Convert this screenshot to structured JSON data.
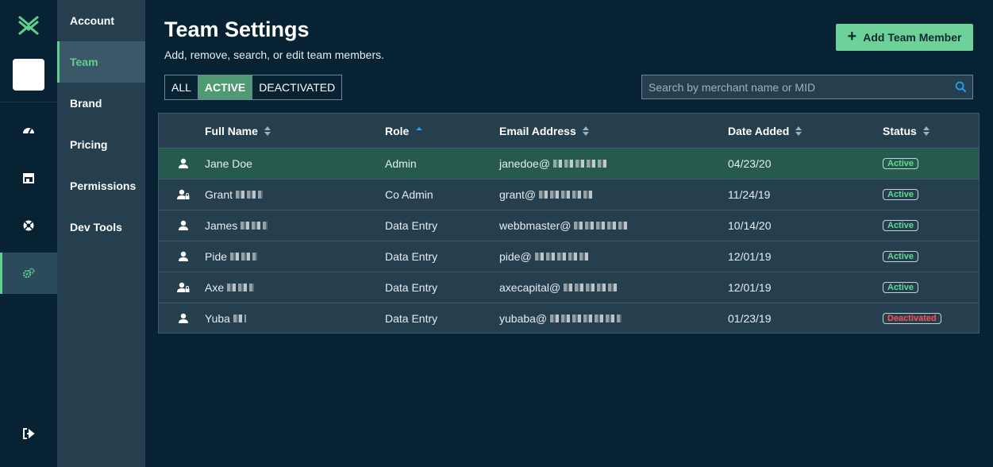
{
  "rail": {
    "icons": [
      "logo-icon",
      "dashboard-icon",
      "store-icon",
      "support-icon",
      "settings-icon",
      "logout-icon"
    ]
  },
  "subnav": {
    "items": [
      {
        "label": "Account",
        "active": false
      },
      {
        "label": "Team",
        "active": true
      },
      {
        "label": "Brand",
        "active": false
      },
      {
        "label": "Pricing",
        "active": false
      },
      {
        "label": "Permissions",
        "active": false
      },
      {
        "label": "Dev Tools",
        "active": false
      }
    ]
  },
  "header": {
    "title": "Team Settings",
    "subtitle": "Add, remove, search, or edit team members.",
    "add_button": "Add Team Member"
  },
  "filters": {
    "all": "ALL",
    "active": "ACTIVE",
    "deactivated": "DEACTIVATED",
    "selected": "ACTIVE"
  },
  "search": {
    "placeholder": "Search by merchant name or MID"
  },
  "table": {
    "columns": {
      "name": "Full Name",
      "role": "Role",
      "email": "Email Address",
      "date": "Date Added",
      "status": "Status"
    },
    "sorted_by": "Role",
    "rows": [
      {
        "name": "Jane Doe",
        "role": "Admin",
        "email": "janedoe@",
        "date": "04/23/20",
        "status": "Active",
        "user_icon": "user-icon"
      },
      {
        "name": "Grant",
        "role": "Co Admin",
        "email": "grant@",
        "date": "11/24/19",
        "status": "Active",
        "user_icon": "user-lock-icon"
      },
      {
        "name": "James",
        "role": "Data Entry",
        "email": "webbmaster@",
        "date": "10/14/20",
        "status": "Active",
        "user_icon": "user-icon"
      },
      {
        "name": "Pide",
        "role": "Data Entry",
        "email": "pide@",
        "date": "12/01/19",
        "status": "Active",
        "user_icon": "user-icon"
      },
      {
        "name": "Axe",
        "role": "Data Entry",
        "email": "axecapital@",
        "date": "12/01/19",
        "status": "Active",
        "user_icon": "user-lock-icon"
      },
      {
        "name": "Yuba",
        "role": "Data Entry",
        "email": "yubaba@",
        "date": "01/23/19",
        "status": "Deactivated",
        "user_icon": "user-icon"
      }
    ]
  },
  "colors": {
    "background": "#062233",
    "panel": "#253f4e",
    "accent": "#5fcf8e",
    "selected_row": "#275a4e",
    "deactivated": "#ff4f4f"
  }
}
